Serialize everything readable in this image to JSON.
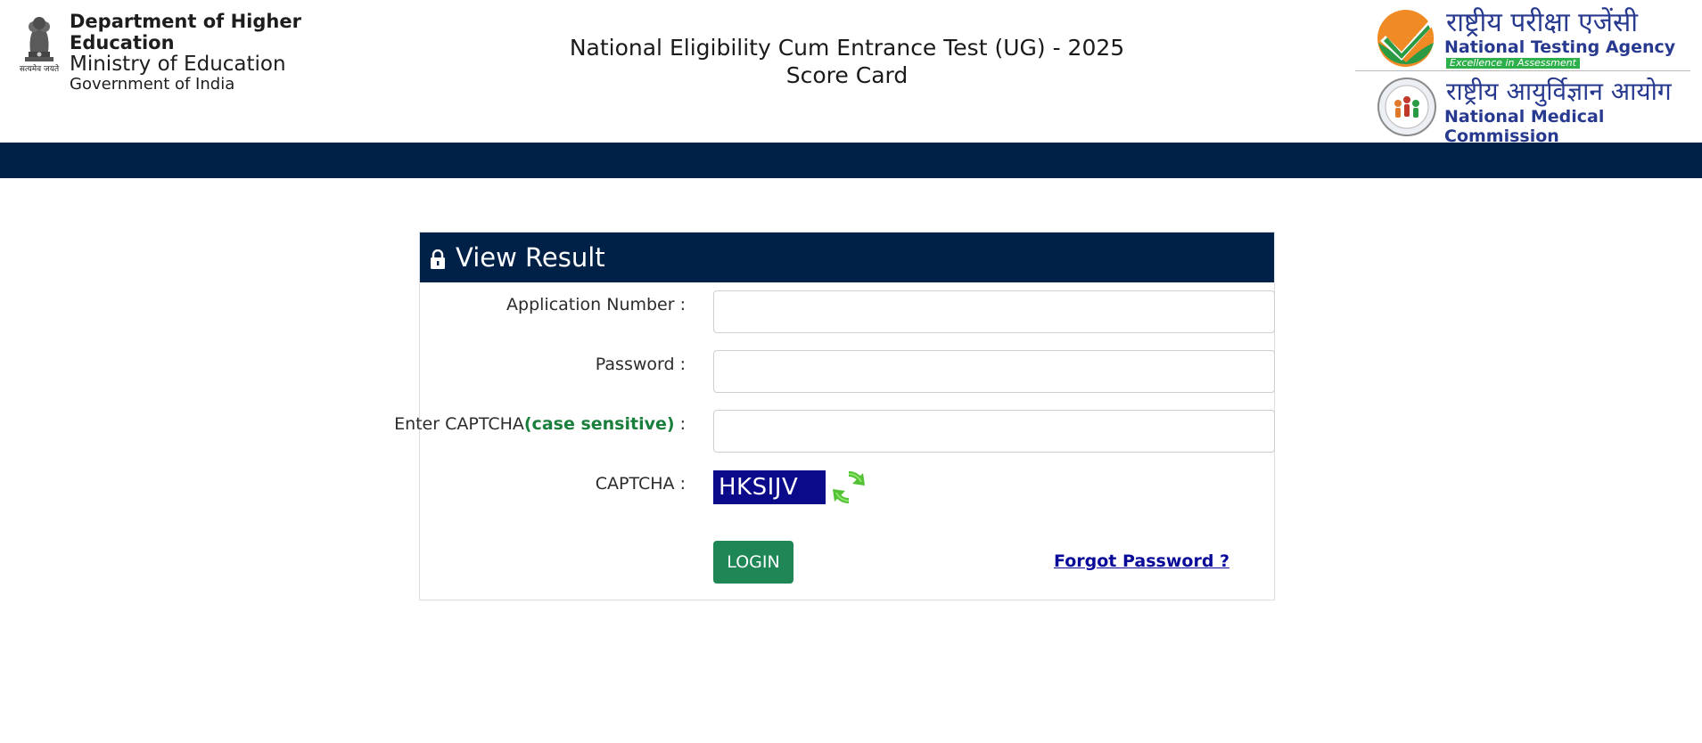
{
  "header": {
    "emblem_caption": "सत्यमेव जयते",
    "dept_line1": "Department of Higher Education",
    "dept_line2": "Ministry of Education",
    "dept_line3": "Government of India",
    "title_line1": "National Eligibility Cum Entrance Test (UG) - 2025",
    "title_line2": "Score Card",
    "nta_hindi": "राष्ट्रीय परीक्षा एजेंसी",
    "nta_english": "National Testing Agency",
    "nta_tagline": "Excellence in Assessment",
    "nmc_hindi": "राष्ट्रीय आयुर्विज्ञान आयोग",
    "nmc_english": "National Medical Commission"
  },
  "colors": {
    "navy": "#002147",
    "login_green": "#1f8756",
    "case_sensitive_green": "#1a7f3c",
    "link_blue": "#0a0a9a",
    "captcha_bg": "#0a0a8a",
    "nta_orange": "#f08a24",
    "nta_green": "#2db04b"
  },
  "panel": {
    "title": "View Result",
    "lock_icon": "lock-icon",
    "fields": {
      "application_number_label": "Application Number :",
      "application_number_value": "",
      "password_label": "Password :",
      "password_value": "",
      "captcha_label_prefix": "Enter CAPTCHA",
      "captcha_label_highlight": "(case sensitive)",
      "captcha_label_suffix": " :",
      "captcha_input_value": "",
      "captcha_display_label": "CAPTCHA :",
      "captcha_text": "HKSIJV"
    },
    "refresh_icon": "refresh-icon",
    "login_label": "LOGIN",
    "forgot_password_label": "Forgot Password ?"
  }
}
